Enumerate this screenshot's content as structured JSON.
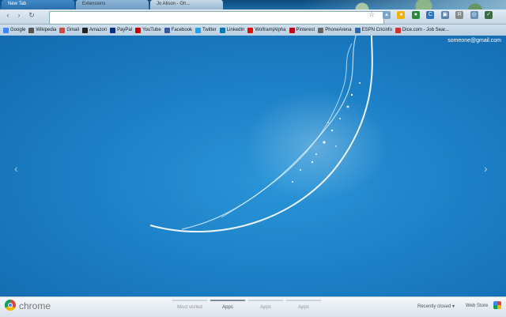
{
  "tabs": [
    {
      "label": "New Tab"
    },
    {
      "label": "Extensions"
    },
    {
      "label": "Jo Alison - Gh..."
    }
  ],
  "toolbar": {
    "back_icon": "back-arrow-icon",
    "forward_icon": "forward-arrow-icon",
    "reload_icon": "reload-icon",
    "omnibox_value": ""
  },
  "bookmarks": [
    {
      "label": "Google",
      "color": "#4285f4"
    },
    {
      "label": "Wikipedia",
      "color": "#555555"
    },
    {
      "label": "Gmail",
      "color": "#d44638"
    },
    {
      "label": "Amazon",
      "color": "#222222"
    },
    {
      "label": "PayPal",
      "color": "#003087"
    },
    {
      "label": "YouTube",
      "color": "#cc0000"
    },
    {
      "label": "Facebook",
      "color": "#3b5998"
    },
    {
      "label": "Twitter",
      "color": "#1da1f2"
    },
    {
      "label": "LinkedIn",
      "color": "#0077b5"
    },
    {
      "label": "Wolfram|Alpha",
      "color": "#dd1100"
    },
    {
      "label": "Pinterest",
      "color": "#bd081c"
    },
    {
      "label": "PhoneArena",
      "color": "#666666"
    },
    {
      "label": "ESPN Cricinfo",
      "color": "#2b6cb0"
    },
    {
      "label": "Dice.com - Job Sear...",
      "color": "#cc3333"
    }
  ],
  "user": {
    "email": "someone@gmail.com"
  },
  "footer": {
    "brand": "chrome",
    "page_tabs": [
      {
        "label": "Most visited"
      },
      {
        "label": "Apps"
      },
      {
        "label": "Apps"
      },
      {
        "label": "Apps"
      }
    ],
    "recently_closed": "Recently closed ▾",
    "web_store": "Web Store"
  }
}
